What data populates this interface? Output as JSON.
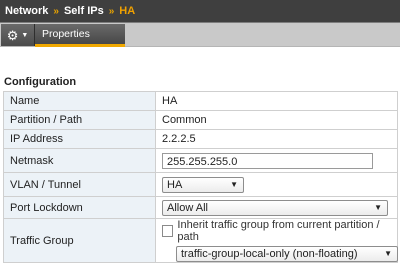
{
  "breadcrumb": {
    "items": [
      "Network",
      "Self IPs"
    ],
    "separator": "»",
    "current": "HA"
  },
  "tabs": {
    "properties_label": "Properties"
  },
  "icons": {
    "gear": "gear-icon",
    "chevron": "chevron-down-icon"
  },
  "section": {
    "title": "Configuration"
  },
  "fields": {
    "name": {
      "label": "Name",
      "value": "HA"
    },
    "partition": {
      "label": "Partition / Path",
      "value": "Common"
    },
    "ip": {
      "label": "IP Address",
      "value": "2.2.2.5"
    },
    "netmask": {
      "label": "Netmask",
      "value": "255.255.255.0"
    },
    "vlan": {
      "label": "VLAN / Tunnel",
      "value": "HA"
    },
    "port_lockdown": {
      "label": "Port Lockdown",
      "value": "Allow All"
    },
    "traffic_group": {
      "label": "Traffic Group",
      "inherit_label": "Inherit traffic group from current partition / path",
      "value": "traffic-group-local-only (non-floating)"
    }
  },
  "colors": {
    "accent": "#f0a800",
    "label_bg": "#ecf2f7",
    "header_bg": "#3f3f3f"
  }
}
